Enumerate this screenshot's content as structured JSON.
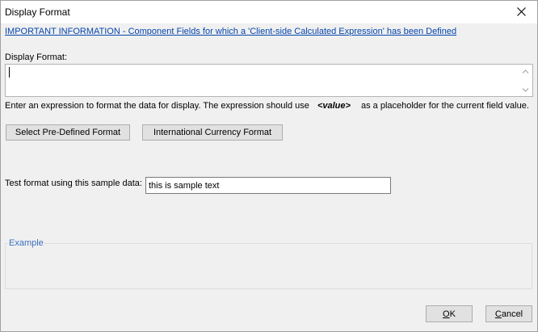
{
  "window": {
    "title": "Display Format",
    "close_icon": "close-icon"
  },
  "info_link": "IMPORTANT INFORMATION - Component Fields for which a 'Client-side Calculated Expression' has been Defined",
  "display_format": {
    "label": "Display Format:",
    "value": ""
  },
  "hint": {
    "before": "Enter an expression to format the data for display. The expression should use",
    "placeholder_token": "<value>",
    "after": "as a placeholder for the current field value."
  },
  "buttons": {
    "predefined": "Select Pre-Defined Format",
    "currency": "International Currency Format",
    "ok_rest": "K",
    "ok_mnemonic": "O",
    "cancel_mnemonic": "C",
    "cancel_rest": "ancel"
  },
  "sample": {
    "label": "Test format using this sample data:",
    "value": "this is sample text"
  },
  "example": {
    "legend": "Example"
  },
  "colors": {
    "link": "#0645ad",
    "legend": "#3c6fc0",
    "background": "#f0f0f0"
  }
}
